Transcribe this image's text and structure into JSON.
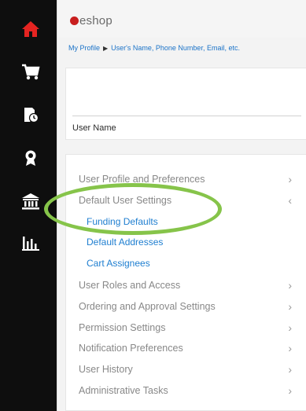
{
  "app": {
    "name": "eshop"
  },
  "nav": [
    {
      "name": "home-icon",
      "color": "#e52421"
    },
    {
      "name": "cart-icon",
      "color": "#ffffff"
    },
    {
      "name": "order-history-icon",
      "color": "#ffffff"
    },
    {
      "name": "award-icon",
      "color": "#ffffff"
    },
    {
      "name": "institution-icon",
      "color": "#ffffff"
    },
    {
      "name": "reports-icon",
      "color": "#ffffff"
    }
  ],
  "breadcrumb": {
    "root": "My Profile",
    "current": "User's Name, Phone Number, Email, etc."
  },
  "user": {
    "label": "User Name"
  },
  "menu": {
    "user_profile": "User Profile and Preferences",
    "default_settings": "Default User Settings",
    "sub_items": [
      "Funding Defaults",
      "Default Addresses",
      "Cart Assignees"
    ],
    "items": [
      "User Roles and Access",
      "Ordering and Approval Settings",
      "Permission Settings",
      "Notification Preferences",
      "User History",
      "Administrative Tasks"
    ]
  },
  "colors": {
    "link": "#1e7ed0",
    "highlight": "#86c44a",
    "sidebar": "#0e0e0e"
  }
}
